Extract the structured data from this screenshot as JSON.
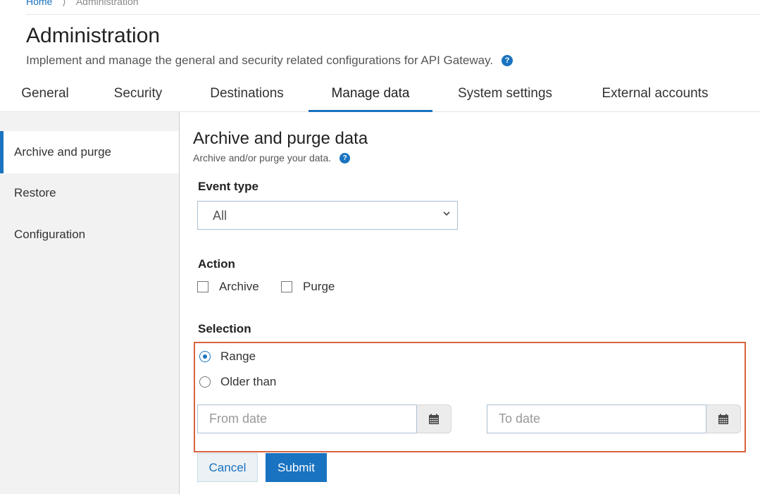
{
  "breadcrumb": {
    "home": "Home",
    "separator": "⟩",
    "current": "Administration"
  },
  "header": {
    "title": "Administration",
    "description": "Implement and manage the general and security related configurations for API Gateway.",
    "help_icon": "?"
  },
  "tabs": [
    {
      "label": "General",
      "active": false
    },
    {
      "label": "Security",
      "active": false
    },
    {
      "label": "Destinations",
      "active": false
    },
    {
      "label": "Manage data",
      "active": true
    },
    {
      "label": "System settings",
      "active": false
    },
    {
      "label": "External accounts",
      "active": false
    }
  ],
  "sidebar": {
    "items": [
      {
        "label": "Archive and purge",
        "active": true
      },
      {
        "label": "Restore",
        "active": false
      },
      {
        "label": "Configuration",
        "active": false
      }
    ]
  },
  "main": {
    "title": "Archive and purge data",
    "description": "Archive and/or purge your data.",
    "help_icon": "?",
    "event_type": {
      "label": "Event type",
      "value": "All"
    },
    "action": {
      "label": "Action",
      "options": [
        {
          "label": "Archive",
          "checked": false
        },
        {
          "label": "Purge",
          "checked": false
        }
      ]
    },
    "selection": {
      "label": "Selection",
      "options": [
        {
          "label": "Range",
          "selected": true
        },
        {
          "label": "Older than",
          "selected": false
        }
      ],
      "from_date": {
        "placeholder": "From date",
        "value": ""
      },
      "to_date": {
        "placeholder": "To date",
        "value": ""
      }
    },
    "buttons": {
      "cancel": "Cancel",
      "submit": "Submit"
    }
  },
  "colors": {
    "accent": "#1a73c0",
    "highlight_border": "#d8633f",
    "sidebar_bg": "#f2f2f2"
  }
}
